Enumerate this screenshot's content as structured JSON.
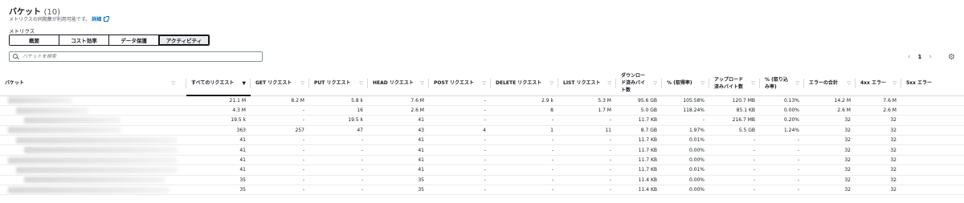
{
  "header": {
    "title": "バケット",
    "count": "(10)"
  },
  "subtitle": {
    "text": "メトリクスの同期集が利用可能です。",
    "link": "詳細"
  },
  "metrics": {
    "label": "メトリクス",
    "tabs": [
      "概要",
      "コスト効率",
      "データ保護",
      "アクティビティ"
    ],
    "active": "アクティビティ"
  },
  "search": {
    "placeholder": "バケットを検索"
  },
  "pagination": {
    "prev": "‹",
    "page": "1",
    "next": "›"
  },
  "table": {
    "columns": [
      "バケット",
      "すべてのリクエスト",
      "GET リクエスト",
      "PUT リクエスト",
      "HEAD リクエスト",
      "POST リクエスト",
      "DELETE リクエスト",
      "LIST リクエスト",
      "ダウンロード済みバイト数",
      "% (取得率)",
      "アップロード済みバイト数",
      "% (取り込み率)",
      "エラーの合計",
      "4xx エラー",
      "5xx エラー"
    ],
    "rows": [
      [
        "",
        "21.1 M",
        "8.2 M",
        "5.8 k",
        "7.6 M",
        "-",
        "2.9 k",
        "5.3 M",
        "95.6 GB",
        "105.58%",
        "120.7 MB",
        "0.13%",
        "14.2 M",
        "7.6 M",
        ""
      ],
      [
        "",
        "4.3 M",
        "-",
        "16",
        "2.6 M",
        "-",
        "8",
        "1.7 M",
        "5.0 GB",
        "118.24%",
        "85.1 KB",
        "0.00%",
        "2.6 M",
        "2.6 M",
        ""
      ],
      [
        "",
        "19.5 k",
        "-",
        "19.5 k",
        "41",
        "-",
        "-",
        "-",
        "11.7 KB",
        "-",
        "216.7 MB",
        "0.20%",
        "32",
        "32",
        ""
      ],
      [
        "",
        "363",
        "257",
        "47",
        "43",
        "4",
        "1",
        "11",
        "8.7 GB",
        "1.97%",
        "5.5 GB",
        "1.24%",
        "32",
        "32",
        ""
      ],
      [
        "",
        "41",
        "-",
        "-",
        "41",
        "-",
        "-",
        "-",
        "11.7 KB",
        "0.01%",
        "-",
        "-",
        "32",
        "32",
        ""
      ],
      [
        "",
        "41",
        "-",
        "-",
        "41",
        "-",
        "-",
        "-",
        "11.7 KB",
        "0.00%",
        "-",
        "-",
        "32",
        "32",
        ""
      ],
      [
        "",
        "41",
        "-",
        "-",
        "41",
        "-",
        "-",
        "-",
        "11.7 KB",
        "0.00%",
        "-",
        "-",
        "32",
        "32",
        ""
      ],
      [
        "",
        "41",
        "-",
        "-",
        "41",
        "-",
        "-",
        "-",
        "11.7 KB",
        "0.01%",
        "-",
        "-",
        "32",
        "32",
        ""
      ],
      [
        "",
        "35",
        "-",
        "-",
        "35",
        "-",
        "-",
        "-",
        "11.4 KB",
        "0.00%",
        "-",
        "-",
        "32",
        "32",
        ""
      ],
      [
        "",
        "35",
        "-",
        "-",
        "35",
        "-",
        "-",
        "-",
        "11.4 KB",
        "0.00%",
        "-",
        "-",
        "32",
        "32",
        ""
      ]
    ]
  },
  "colors": {
    "link": "#0073bb",
    "border": "#d5dbdb",
    "text": "#16191f"
  }
}
